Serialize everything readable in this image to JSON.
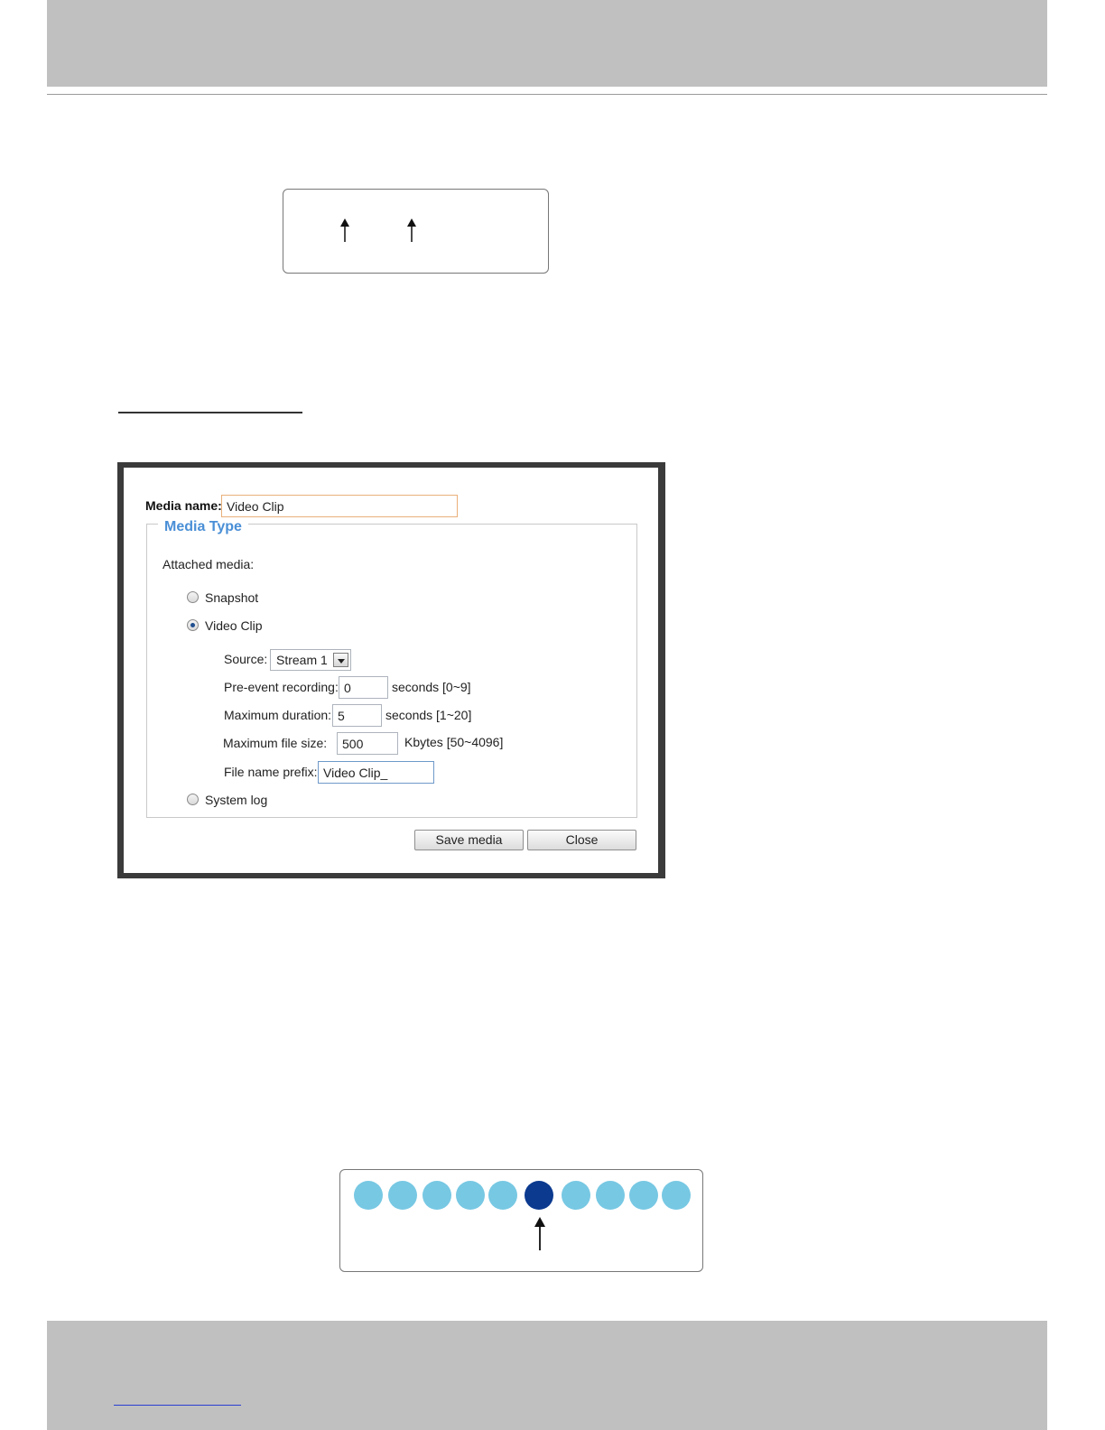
{
  "dialog": {
    "media_name_label": "Media name:",
    "media_name_value": "Video Clip",
    "media_type_legend": "Media Type",
    "attached_media_label": "Attached media:",
    "options": {
      "snapshot": "Snapshot",
      "video_clip": "Video Clip",
      "system_log": "System log"
    },
    "selected_option": "video_clip",
    "source_label": "Source:",
    "source_value": "Stream 1",
    "pre_event_label": "Pre-event recording:",
    "pre_event_value": "0",
    "pre_event_unit": "seconds [0~9]",
    "max_duration_label": "Maximum duration:",
    "max_duration_value": "5",
    "max_duration_unit": "seconds [1~20]",
    "max_file_size_label": "Maximum file size:",
    "max_file_size_value": "500",
    "max_file_size_unit": "Kbytes [50~4096]",
    "file_prefix_label": "File name prefix:",
    "file_prefix_value": "Video Clip_",
    "save_button": "Save media",
    "close_button": "Close"
  },
  "diagram_dots": {
    "count": 10,
    "active_index": 5,
    "colors": {
      "inactive": "#77c8e3",
      "active": "#0b3a8f"
    }
  }
}
